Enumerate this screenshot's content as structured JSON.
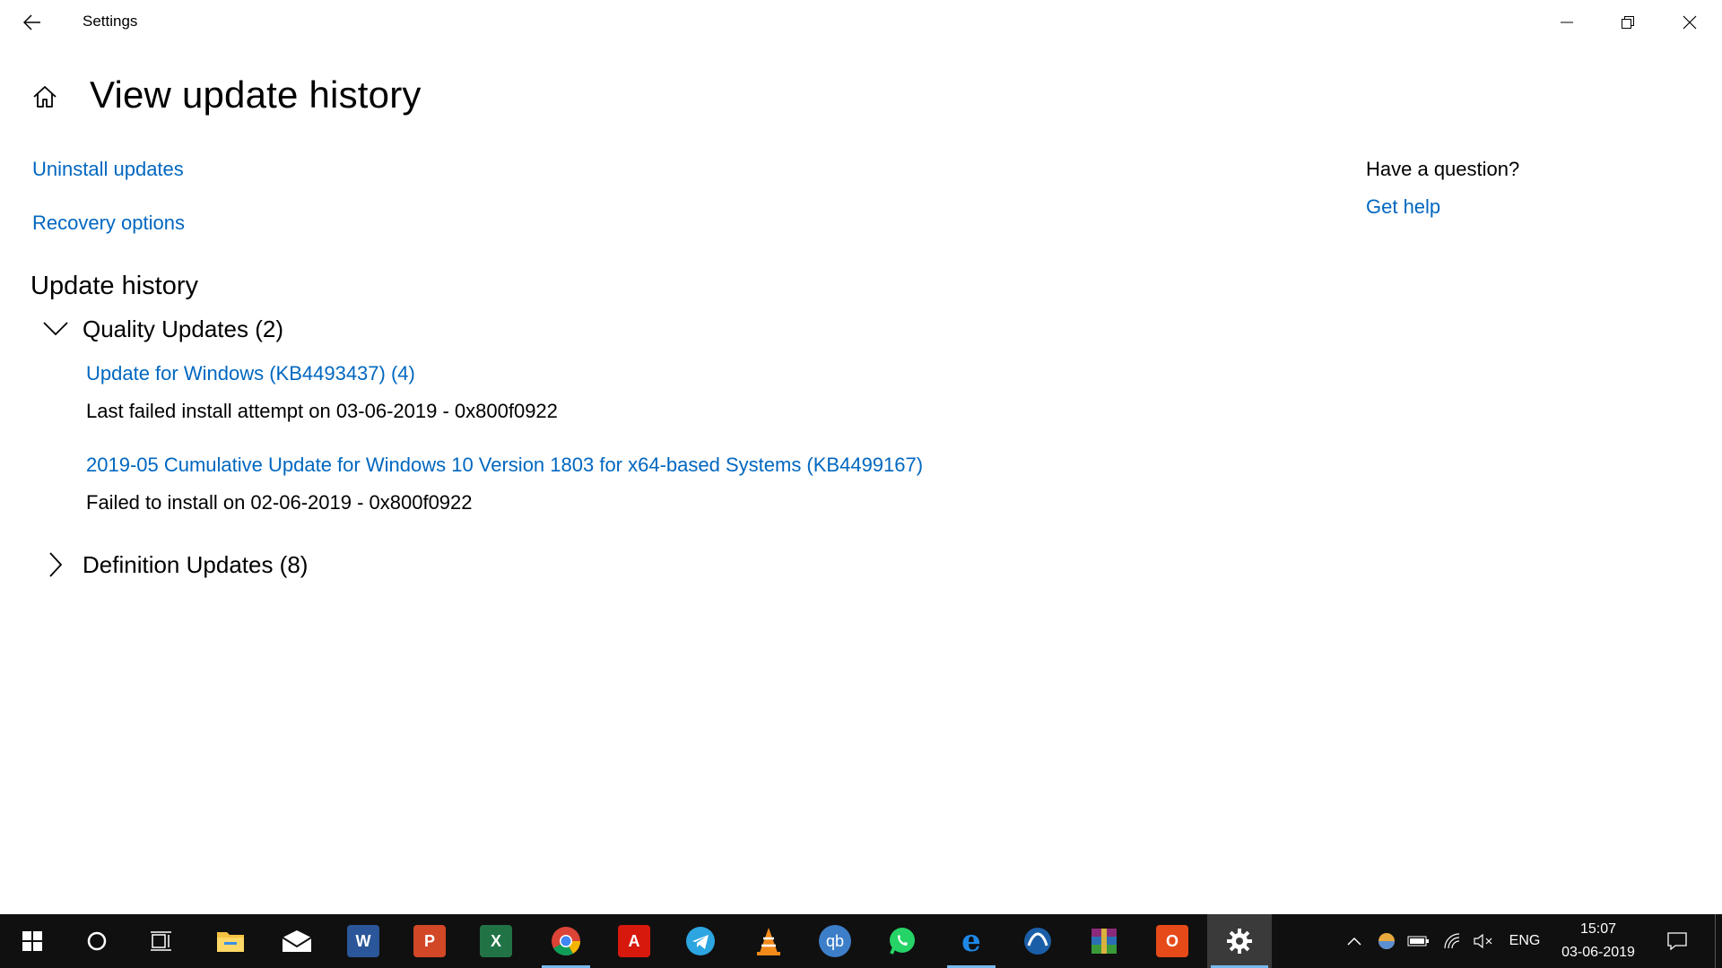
{
  "window": {
    "title": "Settings",
    "controls": {
      "minimize": "minimize",
      "maximize": "restore",
      "close": "close"
    }
  },
  "header": {
    "title": "View update history"
  },
  "links": {
    "uninstall": "Uninstall updates",
    "recovery": "Recovery options"
  },
  "help": {
    "question": "Have a question?",
    "link": "Get help"
  },
  "history": {
    "title": "Update history",
    "quality": {
      "label": "Quality Updates (2)",
      "expanded": true,
      "items": [
        {
          "title": "Update for Windows (KB4493437) (4)",
          "status": "Last failed install attempt on 03-06-2019 - 0x800f0922"
        },
        {
          "title": "2019-05 Cumulative Update for Windows 10 Version 1803 for x64-based Systems (KB4499167)",
          "status": "Failed to install on 02-06-2019 - 0x800f0922"
        }
      ]
    },
    "definitions": {
      "label": "Definition Updates (8)",
      "expanded": false
    }
  },
  "taskbar": {
    "apps": [
      "file-explorer",
      "mail",
      "word",
      "powerpoint",
      "excel",
      "chrome",
      "acrobat",
      "telegram",
      "vlc",
      "qbittorrent",
      "whatsapp",
      "edge",
      "cloud-app",
      "winrar",
      "office",
      "settings"
    ],
    "qb_label": "qb",
    "tray": {
      "language": "ENG",
      "time": "15:07",
      "date": "03-06-2019"
    }
  },
  "colors": {
    "accent": "#0067c0",
    "taskbar": "#101010",
    "indicator": "#76b9ed"
  }
}
